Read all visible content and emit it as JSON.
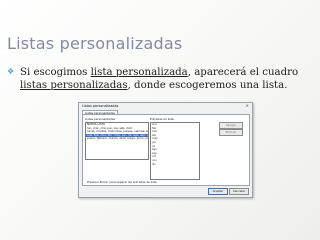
{
  "slide": {
    "title": "Listas personalizadas",
    "bullet": {
      "pre": "Si escogimos ",
      "link1": "lista personalizada",
      "mid": ", aparecerá el cuadro ",
      "link2": "listas personalizadas",
      "post": ", donde escogeremos una lista."
    },
    "bullet_color": "#4fa3c8",
    "title_color": "#7f8ba7"
  },
  "dialog": {
    "title": "Listas personalizadas",
    "close_icon": "close-icon",
    "tab_label": "Listas personalizadas",
    "list_label": "Listas personalizadas:",
    "entries_label": "Entradas de lista:",
    "lists": [
      "NUEVA LISTA",
      "lun, mar, mié, jue, vie, sáb, dom",
      "lunes, martes, miércoles, jueves, viernes, sábado, domingo",
      "ene, feb, mar, abr, may, jun, jul, ago, sep, oct, nov, dic",
      "enero, febrero, marzo, abril, mayo, junio, julio"
    ],
    "selected_index": 3,
    "entries": [
      "ene",
      "feb",
      "mar",
      "abr",
      "may",
      "jun",
      "jul",
      "ago",
      "sep",
      "oct",
      "nov",
      "dic"
    ],
    "buttons": {
      "add": "Agregar",
      "delete": "Eliminar"
    },
    "hint": "Presione Entrar para separar las entradas de lista.",
    "footer": {
      "ok": "Aceptar",
      "cancel": "Cancelar"
    }
  }
}
